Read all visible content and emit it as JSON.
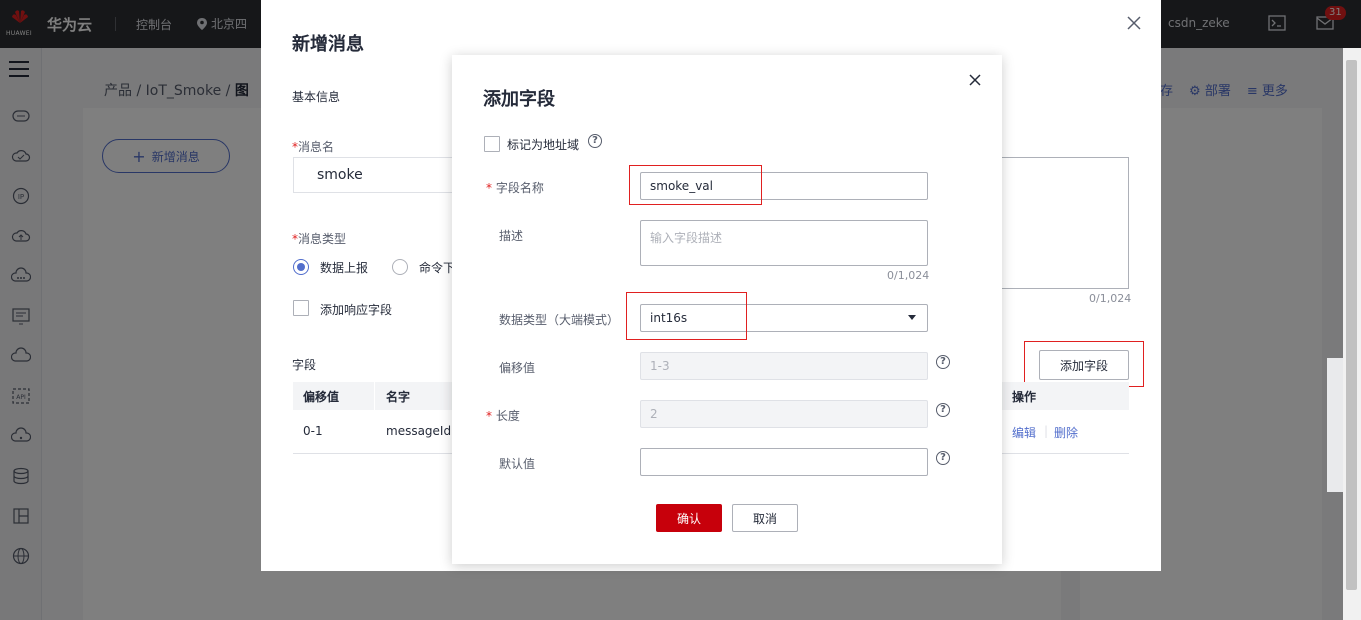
{
  "topbar": {
    "logo_text": "HUAWEI",
    "brand": "华为云",
    "console": "控制台",
    "region": "北京四",
    "user": "csdn_zeke",
    "badge": "31"
  },
  "background": {
    "breadcrumb": [
      "产品",
      "IoT_Smoke",
      "图"
    ],
    "add_message": "新增消息",
    "actions": [
      "存",
      "部署",
      "更多"
    ]
  },
  "dialog1": {
    "title": "新增消息",
    "basic_info": "基本信息",
    "msg_name_label": "消息名",
    "msg_name_value": "smoke",
    "msg_type_label": "消息类型",
    "types": [
      "数据上报",
      "命令下"
    ],
    "add_response": "添加响应字段",
    "fields_section": "字段",
    "columns": [
      "偏移值",
      "名字",
      "操作"
    ],
    "row": {
      "offset": "0-1",
      "name": "messageId",
      "edit": "编辑",
      "delete": "删除"
    },
    "desc_count": "0/1,024",
    "add_field_btn": "添加字段"
  },
  "dialog2": {
    "title": "添加字段",
    "mark_address": "标记为地址域",
    "name_label": "字段名称",
    "name_value": "smoke_val",
    "desc_label": "描述",
    "desc_placeholder": "输入字段描述",
    "desc_count": "0/1,024",
    "type_label": "数据类型（大端模式）",
    "type_value": "int16s",
    "offset_label": "偏移值",
    "offset_value": "1-3",
    "length_label": "长度",
    "length_value": "2",
    "default_label": "默认值",
    "default_value": "",
    "confirm": "确认",
    "cancel": "取消"
  }
}
